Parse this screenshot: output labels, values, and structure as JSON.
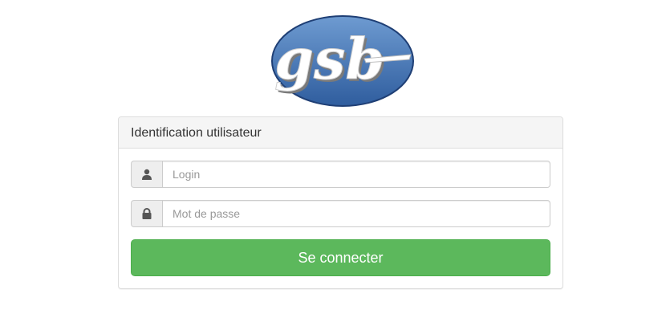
{
  "logo": {
    "text": "gsb"
  },
  "panel": {
    "title": "Identification utilisateur"
  },
  "form": {
    "login_placeholder": "Login",
    "password_placeholder": "Mot de passe",
    "submit_label": "Se connecter"
  },
  "icons": {
    "login": "user-icon",
    "password": "lock-icon"
  },
  "colors": {
    "accent": "#5cb85c",
    "logo_blue": "#4a7ab5"
  }
}
